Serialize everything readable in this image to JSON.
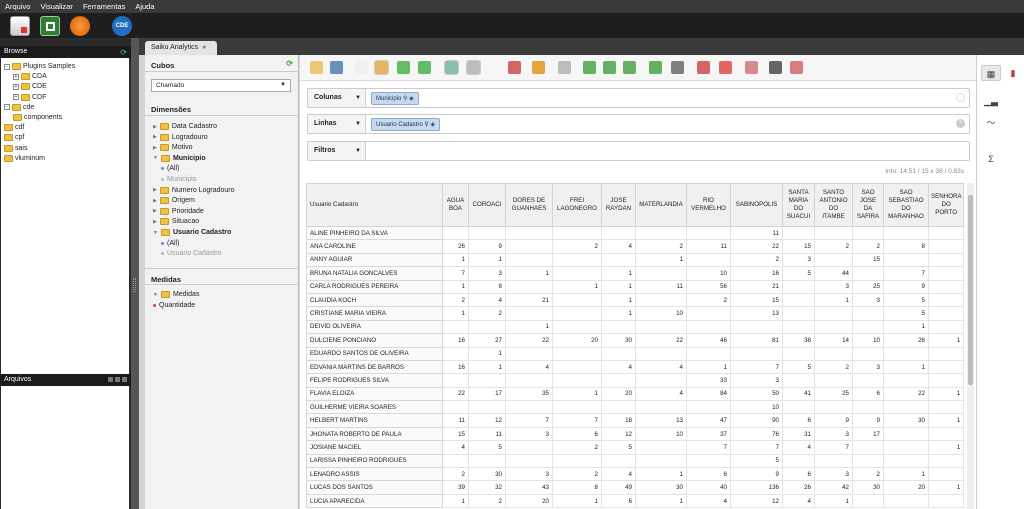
{
  "menu": [
    "Arquivo",
    "Visualizar",
    "Ferramentas",
    "Ajuda"
  ],
  "toolbar": {
    "cde_label": "CDE"
  },
  "browse": {
    "title": "Browse",
    "tree": [
      {
        "label": "Plugins Samples",
        "level": 0,
        "expand": "-"
      },
      {
        "label": "CDA",
        "level": 1,
        "expand": "+"
      },
      {
        "label": "CDE",
        "level": 1,
        "expand": "+"
      },
      {
        "label": "CDF",
        "level": 1,
        "expand": "+"
      },
      {
        "label": "cde",
        "level": 0,
        "expand": "-"
      },
      {
        "label": "components",
        "level": 1,
        "expand": ""
      },
      {
        "label": "cdf",
        "level": 0,
        "expand": ""
      },
      {
        "label": "cpf",
        "level": 0,
        "expand": ""
      },
      {
        "label": "sais",
        "level": 0,
        "expand": ""
      },
      {
        "label": "vluminum",
        "level": 0,
        "expand": ""
      }
    ]
  },
  "arquivos": {
    "title": "Arquivos"
  },
  "tab": {
    "label": "Saiku Analytics"
  },
  "side": {
    "cubos_title": "Cubos",
    "cubo_selected": "Chamado",
    "dimensoes_title": "Dimensões",
    "dimensions": [
      {
        "label": "Data Cadastro",
        "type": "folder",
        "bold": false
      },
      {
        "label": "Logradouro",
        "type": "folder",
        "bold": false
      },
      {
        "label": "Motivo",
        "type": "folder",
        "bold": false
      },
      {
        "label": "Municipio",
        "type": "open",
        "bold": true
      },
      {
        "label": "(All)",
        "type": "dot",
        "bold": false
      },
      {
        "label": "Municipio",
        "type": "dot-grey",
        "bold": false
      },
      {
        "label": "Numero Logradouro",
        "type": "folder",
        "bold": false
      },
      {
        "label": "Origem",
        "type": "folder",
        "bold": false
      },
      {
        "label": "Prioridade",
        "type": "folder",
        "bold": false
      },
      {
        "label": "Situacao",
        "type": "folder",
        "bold": false
      },
      {
        "label": "Usuario Cadastro",
        "type": "open",
        "bold": true
      },
      {
        "label": "(All)",
        "type": "dot",
        "bold": false
      },
      {
        "label": "Usuario Cadastro",
        "type": "dot-grey",
        "bold": false
      }
    ],
    "medidas_title": "Medidas",
    "measures": [
      {
        "label": "Medidas",
        "type": "open"
      },
      {
        "label": "Quantidade",
        "type": "dot-red"
      }
    ]
  },
  "axes": {
    "colunas_label": "Colunas",
    "colunas_chip": "Municipio",
    "linhas_label": "Linhas",
    "linhas_chip": "Usuario Cadastro",
    "filtros_label": "Filtros"
  },
  "info": "Info:  14:51   /  15 x 38  /  0.83s",
  "table": {
    "corner": "Usuario Cadastro",
    "columns": [
      "AGUA BOA",
      "COROACI",
      "DORES DE GUANHAES",
      "FREI LAGONEGRO",
      "JOSE RAYDAN",
      "MATERLANDIA",
      "RIO VERMELHO",
      "SABINOPOLIS",
      "SANTA MARIA DO SUACUI",
      "SANTO ANTONIO DO ITAMBE",
      "SAO JOSE DA SAFIRA",
      "SAO SEBASTIAO DO MARANHAO",
      "SENHORA DO PORTO"
    ],
    "rows": [
      {
        "name": "ALINE PINHEIRO DA SILVA",
        "v": [
          "",
          "",
          "",
          "",
          "",
          "",
          "",
          "11",
          "",
          "",
          "",
          "",
          ""
        ]
      },
      {
        "name": "ANA CAROLINE",
        "v": [
          "26",
          "9",
          "",
          "2",
          "4",
          "2",
          "11",
          "22",
          "15",
          "2",
          "2",
          "8",
          ""
        ]
      },
      {
        "name": "ANNY AGUIAR",
        "v": [
          "1",
          "1",
          "",
          "",
          "",
          "1",
          "",
          "2",
          "3",
          "",
          "15",
          "",
          ""
        ]
      },
      {
        "name": "BRUNA NATALIA GONCALVES",
        "v": [
          "7",
          "3",
          "1",
          "",
          "1",
          "",
          "10",
          "16",
          "5",
          "44",
          "",
          "7",
          ""
        ]
      },
      {
        "name": "CARLA RODRIGUES PEREIRA",
        "v": [
          "1",
          "8",
          "",
          "1",
          "1",
          "11",
          "56",
          "21",
          "",
          "3",
          "25",
          "9",
          ""
        ]
      },
      {
        "name": "CLAUDIA KOCH",
        "v": [
          "2",
          "4",
          "21",
          "",
          "1",
          "",
          "2",
          "15",
          "",
          "1",
          "3",
          "5",
          ""
        ]
      },
      {
        "name": "CRISTIANE MARIA VIEIRA",
        "v": [
          "1",
          "2",
          "",
          "",
          "1",
          "10",
          "",
          "13",
          "",
          "",
          "",
          "5",
          ""
        ]
      },
      {
        "name": "DEIVID OLIVEIRA",
        "v": [
          "",
          "",
          "1",
          "",
          "",
          "",
          "",
          "",
          "",
          "",
          "",
          "1",
          ""
        ]
      },
      {
        "name": "DULCIENE PONCIANO",
        "v": [
          "16",
          "27",
          "22",
          "20",
          "30",
          "22",
          "46",
          "81",
          "38",
          "14",
          "10",
          "26",
          "1"
        ]
      },
      {
        "name": "EDUARDO SANTOS DE OLIVEIRA",
        "v": [
          "",
          "1",
          "",
          "",
          "",
          "",
          "",
          "",
          "",
          "",
          "",
          "",
          ""
        ]
      },
      {
        "name": "EDVANIA MARTINS DE BARROS",
        "v": [
          "16",
          "1",
          "4",
          "",
          "4",
          "4",
          "1",
          "7",
          "5",
          "2",
          "3",
          "1",
          ""
        ]
      },
      {
        "name": "FELIPE RODRIGUES SILVA",
        "v": [
          "",
          "",
          "",
          "",
          "",
          "",
          "33",
          "3",
          "",
          "",
          "",
          "",
          ""
        ]
      },
      {
        "name": "FLAVIA ELOIZA",
        "v": [
          "22",
          "17",
          "35",
          "1",
          "20",
          "4",
          "84",
          "50",
          "41",
          "25",
          "6",
          "22",
          "1"
        ]
      },
      {
        "name": "GUILHERME VIEIRA SOARES",
        "v": [
          "",
          "",
          "",
          "",
          "",
          "",
          "",
          "10",
          "",
          "",
          "",
          "",
          ""
        ]
      },
      {
        "name": "HELBERT MARTINS",
        "v": [
          "11",
          "12",
          "7",
          "7",
          "18",
          "13",
          "47",
          "90",
          "6",
          "9",
          "9",
          "30",
          "1"
        ]
      },
      {
        "name": "JHONATA ROBERTO DE PAULA",
        "v": [
          "15",
          "11",
          "3",
          "6",
          "12",
          "10",
          "37",
          "76",
          "31",
          "3",
          "17",
          "",
          ""
        ]
      },
      {
        "name": "JOSIANE MACIEL",
        "v": [
          "4",
          "5",
          "",
          "2",
          "5",
          "",
          "7",
          "7",
          "4",
          "7",
          "",
          "",
          "1"
        ]
      },
      {
        "name": "LARISSA PINHEIRO RODRIGUES",
        "v": [
          "",
          "",
          "",
          "",
          "",
          "",
          "",
          "5",
          "",
          "",
          "",
          "",
          ""
        ]
      },
      {
        "name": "LENADRO ASSIS",
        "v": [
          "2",
          "30",
          "3",
          "2",
          "4",
          "1",
          "6",
          "9",
          "6",
          "3",
          "2",
          "1",
          ""
        ]
      },
      {
        "name": "LUCAS DOS SANTOS",
        "v": [
          "39",
          "32",
          "43",
          "8",
          "49",
          "30",
          "40",
          "136",
          "26",
          "42",
          "30",
          "20",
          "1"
        ]
      },
      {
        "name": "LUCIA APARECIDA",
        "v": [
          "1",
          "2",
          "20",
          "1",
          "6",
          "1",
          "4",
          "12",
          "4",
          "1",
          "",
          "",
          ""
        ]
      }
    ]
  }
}
